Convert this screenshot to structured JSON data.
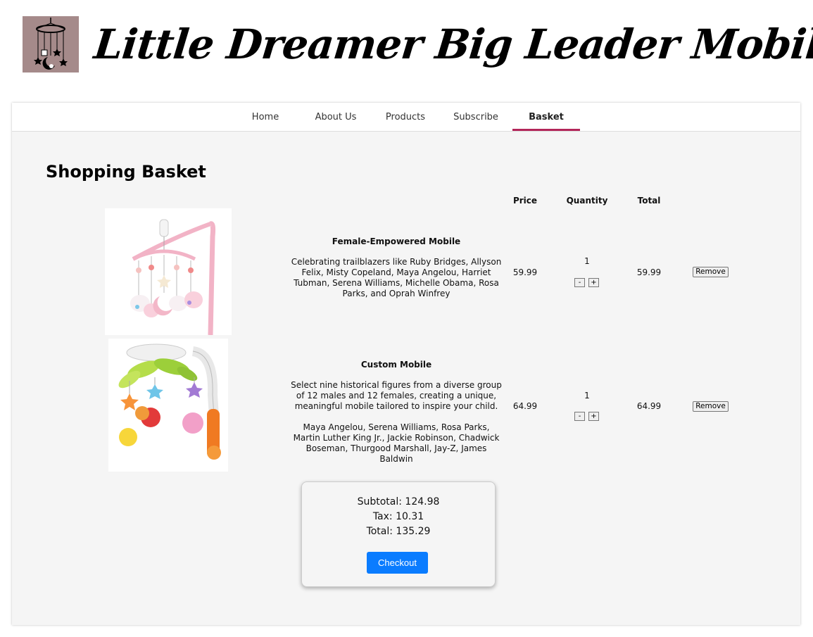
{
  "site": {
    "title": "Little Dreamer Big Leader Mobiles"
  },
  "nav": {
    "items": [
      {
        "label": "Home",
        "active": false
      },
      {
        "label": "About Us",
        "active": false
      },
      {
        "label": "Products",
        "active": false
      },
      {
        "label": "Subscribe",
        "active": false
      },
      {
        "label": "Basket",
        "active": true
      }
    ]
  },
  "basket": {
    "title": "Shopping Basket",
    "columns": {
      "price": "Price",
      "quantity": "Quantity",
      "total": "Total"
    },
    "items": [
      {
        "name": "Female-Empowered Mobile",
        "description": "Celebrating trailblazers like Ruby Bridges, Allyson Felix, Misty Copeland, Maya Angelou, Harriet Tubman, Serena Williams, Michelle Obama, Rosa Parks, and Oprah Winfrey",
        "price": "59.99",
        "quantity": "1",
        "total": "59.99",
        "decrement_label": "-",
        "increment_label": "+",
        "remove_label": "Remove"
      },
      {
        "name": "Custom Mobile",
        "description": "Select nine historical figures from a diverse group of 12 males and 12 females, creating a unique, meaningful mobile tailored to inspire your child.",
        "figures": "Maya Angelou, Serena Williams, Rosa Parks, Martin Luther King Jr., Jackie Robinson, Chadwick Boseman, Thurgood Marshall, Jay-Z, James Baldwin",
        "price": "64.99",
        "quantity": "1",
        "total": "64.99",
        "decrement_label": "-",
        "increment_label": "+",
        "remove_label": "Remove"
      }
    ]
  },
  "summary": {
    "subtotal": "Subtotal: 124.98",
    "tax": "Tax: 10.31",
    "total": "Total: 135.29",
    "checkout_label": "Checkout"
  },
  "colors": {
    "accent": "#b3265a",
    "button": "#0a7cff",
    "logo_bg": "#a58a8a"
  }
}
